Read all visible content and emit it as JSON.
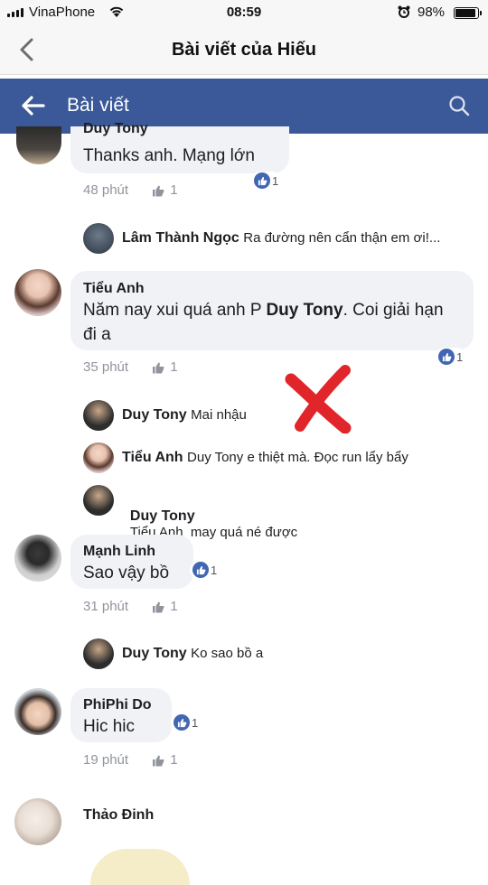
{
  "status_bar": {
    "carrier": "VinaPhone",
    "time": "08:59",
    "battery": "98%",
    "battery_level": 0.98
  },
  "ios_nav": {
    "title": "Bài viết của Hiếu"
  },
  "fb_bar": {
    "title": "Bài viết"
  },
  "comments": [
    {
      "name": "Duy Tony",
      "text": "Thanks anh. Mạng lớn",
      "time": "48 phút",
      "likes": "1",
      "reactions": "1"
    },
    {
      "name": "Tiểu Anh",
      "text_before": "Năm nay xui quá anh P",
      "mention": "Duy Tony",
      "text_after": ". Coi giải hạn đi a",
      "time": "35 phút",
      "likes": "1",
      "reactions": "1"
    },
    {
      "name": "Mạnh Linh",
      "text": "Sao vậy bồ",
      "time": "31 phút",
      "likes": "1",
      "reactions": "1"
    },
    {
      "name": "PhiPhi Do",
      "text": "Hic hic",
      "time": "19 phút",
      "likes": "1",
      "reactions": "1"
    },
    {
      "name": "Thảo Đinh"
    }
  ],
  "replies": [
    {
      "name": "Lâm Thành Ngọc",
      "text": "Ra đường nên cẩn thận em ơi!..."
    },
    {
      "name": "Duy Tony",
      "text": "Mai nhậu"
    },
    {
      "name": "Tiểu Anh",
      "text": "Duy Tony e thiệt mà. Đọc run lẩy bẩy"
    },
    {
      "name": "Duy Tony",
      "text": "Tiểu Anh  may quá né được"
    },
    {
      "name": "Duy Tony",
      "text": "Ko sao bồ a"
    }
  ],
  "colors": {
    "facebook_blue": "#3b5998",
    "like_blue": "#4267b2",
    "mark_red": "#e0262b"
  }
}
